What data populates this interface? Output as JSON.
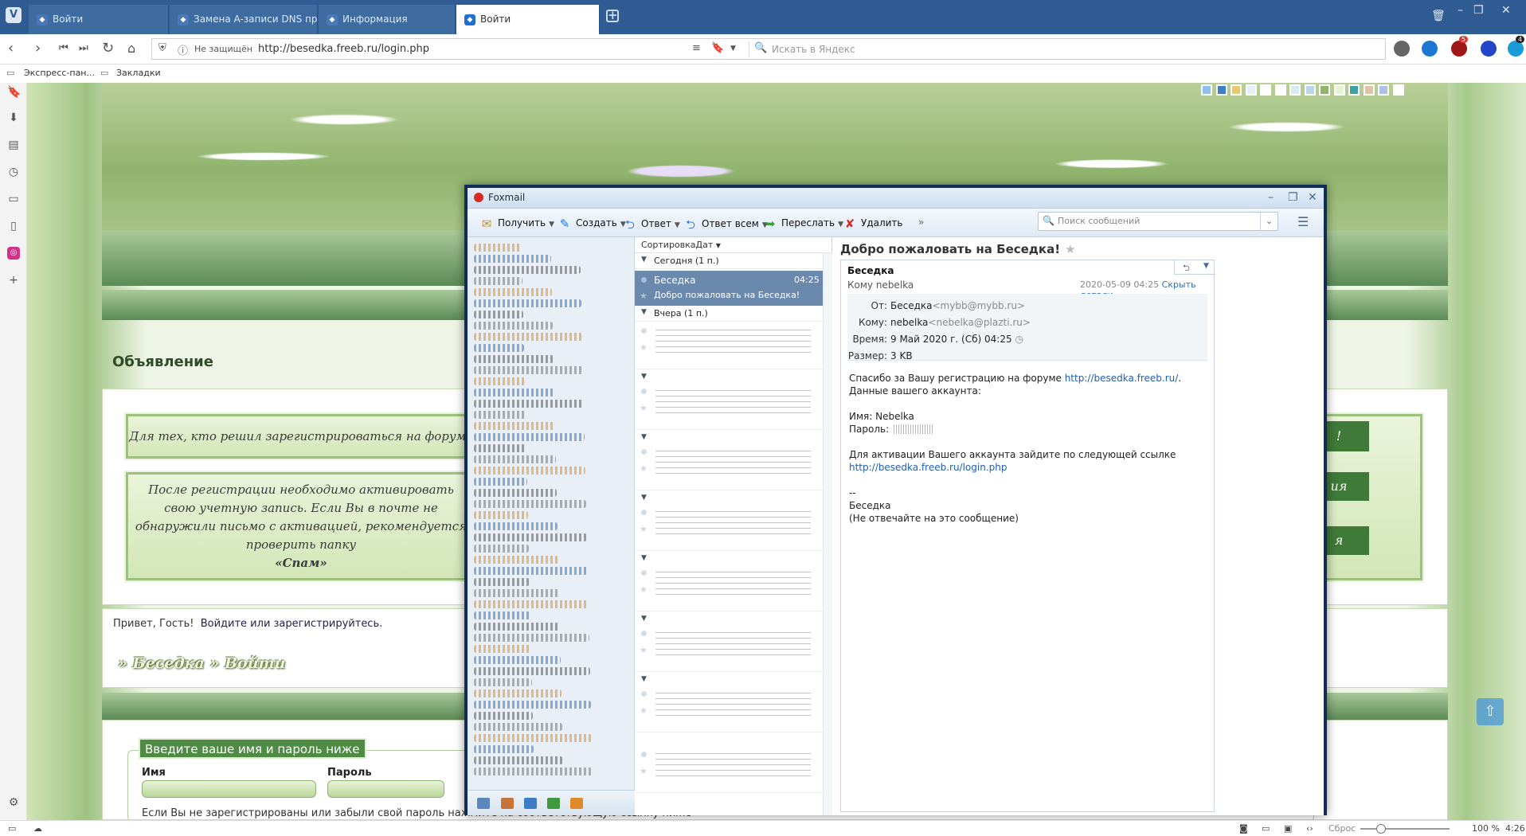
{
  "browser": {
    "tabs": [
      {
        "label": "Войти",
        "active": false
      },
      {
        "label": "Замена A-записи DNS пр",
        "active": false
      },
      {
        "label": "Информация",
        "active": false
      },
      {
        "label": "Войти",
        "active": true
      }
    ],
    "address": {
      "security": "Не защищён",
      "url": "http://besedka.freeb.ru/login.php",
      "search_placeholder": "Искать в Яндекс"
    },
    "bookmarks": [
      "Экспресс-пан...",
      "Закладки"
    ],
    "badges": {
      "ext1": "5",
      "ext2": "4"
    },
    "status": {
      "reset": "Сброс",
      "zoom": "100 %",
      "time": "4:26"
    }
  },
  "forum": {
    "announcement_title": "Объявление",
    "notice1": "Для тех, кто решил зарегистрироваться на форуме",
    "notice2": "После регистрации необходимо активировать свою учетную запись. Если Вы в почте не обнаружили письмо с активацией, рекомендуется проверить папку",
    "notice2_spam": "«Спам»",
    "right_marks": [
      "!",
      "ия",
      "я"
    ],
    "greeting": "Привет, Гость!",
    "greeting_link": "Войдите или зарегистрируйтесь.",
    "breadcrumb": "» Беседка » Войти",
    "login_legend": "Введите ваше имя и пароль ниже",
    "name_label": "Имя",
    "password_label": "Пароль",
    "hint": "Если Вы не зарегистрированы или забыли свой пароль нажмите на соответствующую ссылку ниже"
  },
  "swatches": [
    "#8fc1e8",
    "#3b7fc4",
    "#e6c96a",
    "#e8f0f7",
    "#ffffff",
    "#ffffff",
    "#d6ecf0",
    "#b9d9e8",
    "#8fb56a",
    "#e8f3d0",
    "#3fa0a0",
    "#e0c4a8",
    "#a9c4e2",
    "#ffffff"
  ],
  "foxmail": {
    "title": "Foxmail",
    "toolbar": {
      "receive": "Получить",
      "create": "Создать",
      "reply": "Ответ",
      "reply_all": "Ответ всем",
      "forward": "Переслать",
      "delete": "Удалить",
      "more": "»",
      "search_placeholder": "Поиск сообщений"
    },
    "list": {
      "sort": "СортировкаДат",
      "today": "Сегодня (1 п.)",
      "yesterday": "Вчера (1 п.)",
      "selected": {
        "from": "Беседка",
        "time": "04:25",
        "subject": "Добро пожаловать на Беседка!"
      }
    },
    "message": {
      "subject": "Добро пожаловать на Беседка!",
      "sender": "Беседка",
      "to_line": "Кому nebelka",
      "date": "2020-05-09 04:25",
      "hide_details": "Скрыть детали",
      "from_label": "От:",
      "from_name": "Беседка",
      "from_addr": "<mybb@mybb.ru>",
      "to_label": "Кому:",
      "to_name": "nebelka",
      "to_addr": "<nebelka@plazti.ru>",
      "time_label": "Время:",
      "time_value": "9 Май 2020 г. (Сб) 04:25",
      "size_label": "Размер:",
      "size_value": "3 KB",
      "body_p1": "Спасибо за Вашу регистрацию на форуме ",
      "body_link1": "http://besedka.freeb.ru/",
      "body_p1b": ". Данные вашего аккаунта:",
      "name_line": "Имя: Nebelka",
      "pwd_line": "Пароль: ",
      "activate_line": "Для активации Вашего аккаунта зайдите по следующей ссылке",
      "body_link2": "http://besedka.freeb.ru/login.php",
      "sig_dash": "--",
      "sig_name": "Беседка",
      "sig_note": "(Не отвечайте на это сообщение)"
    }
  }
}
